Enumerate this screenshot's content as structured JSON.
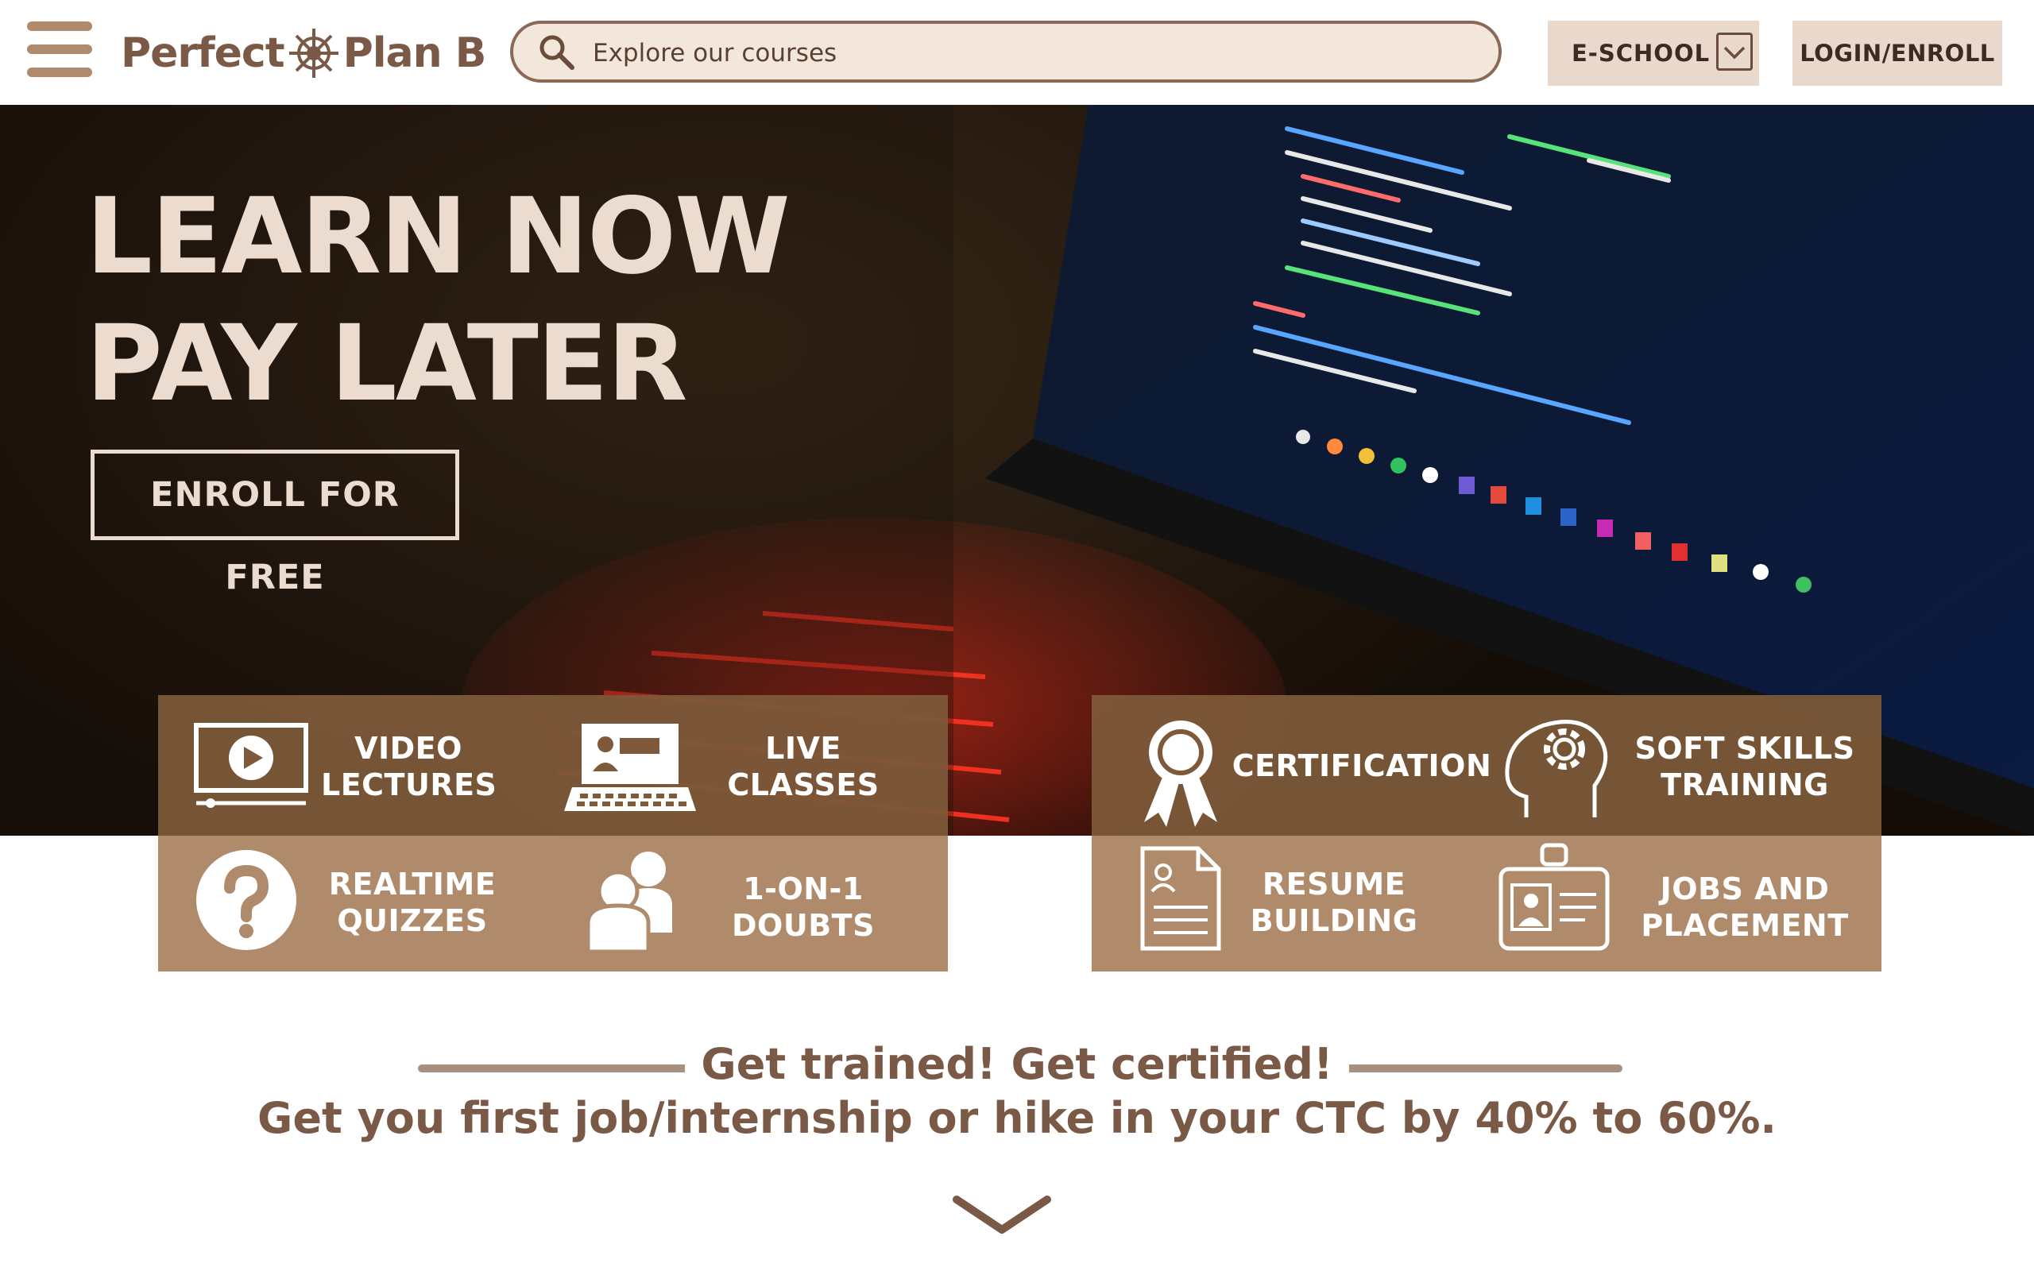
{
  "header": {
    "logo": {
      "text_left": "Perfect",
      "text_right": "Plan B"
    },
    "search": {
      "placeholder": "Explore our courses"
    },
    "eschool_label": "E-SCHOOL",
    "login_label": "LOGIN/ENROLL"
  },
  "hero": {
    "title_line1": "LEARN NOW",
    "title_line2": "PAY LATER",
    "cta_label": "ENROLL FOR FREE"
  },
  "features": {
    "left": [
      {
        "label": "VIDEO\nLECTURES",
        "icon": "video-player-icon"
      },
      {
        "label": "LIVE\nCLASSES",
        "icon": "laptop-presentation-icon"
      },
      {
        "label": "REALTIME\nQUIZZES",
        "icon": "question-mark-icon"
      },
      {
        "label": "1-ON-1\nDOUBTS",
        "icon": "two-people-icon"
      }
    ],
    "right": [
      {
        "label": "CERTIFICATION",
        "icon": "award-ribbon-icon"
      },
      {
        "label": "SOFT SKILLS\nTRAINING",
        "icon": "head-gear-icon"
      },
      {
        "label": "RESUME\nBUILDING",
        "icon": "resume-document-icon"
      },
      {
        "label": "JOBS AND\nPLACEMENT",
        "icon": "id-badge-icon"
      }
    ]
  },
  "tagline": {
    "line1": "Get trained! Get certified!",
    "line2": "Get you first job/internship or hike in your CTC by 40% to 60%."
  },
  "colors": {
    "brand_brown": "#7a5a46",
    "accent_tan": "#b08b6b",
    "dark_brown": "#7e5a3a",
    "cream": "#ecdcd0",
    "button_bg": "#e8d9cc"
  }
}
